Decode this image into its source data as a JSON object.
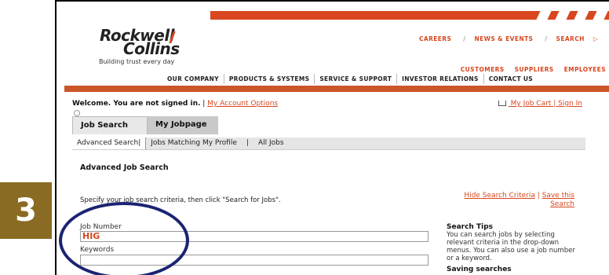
{
  "step_number": "3",
  "brand": {
    "line1": "Rockwell",
    "line2": "Collins",
    "tagline": "Building trust every day"
  },
  "top_links": [
    "CAREERS",
    "NEWS & EVENTS",
    "SEARCH"
  ],
  "audience_links": [
    "CUSTOMERS",
    "SUPPLIERS",
    "EMPLOYEES"
  ],
  "nav": [
    "OUR COMPANY",
    "PRODUCTS & SYSTEMS",
    "SERVICE & SUPPORT",
    "INVESTOR RELATIONS",
    "CONTACT US"
  ],
  "welcome": {
    "text": "Welcome. You are not signed in.",
    "sep": "|",
    "account_link": "My Account Options"
  },
  "cart": {
    "label": "My Job Cart",
    "sep": "|",
    "signin": "Sign In"
  },
  "tabs": [
    "Job Search",
    "My Jobpage"
  ],
  "subtabs": [
    "Advanced Search|",
    "Jobs Matching My Profile",
    "|",
    "All Jobs"
  ],
  "section_title": "Advanced Job Search",
  "criteria_text": "Specify your job search criteria, then click \"Search for Jobs\".",
  "hide_criteria": "Hide Search Criteria",
  "save_search_line1": "Save this",
  "save_search_line2": "Search",
  "job_number": {
    "label": "Job Number",
    "value": "HIG"
  },
  "keywords": {
    "label": "Keywords",
    "value": ""
  },
  "tips": {
    "title": "Search Tips",
    "body": "You can search jobs by selecting relevant criteria in the drop-down menus. You can also use a job number or a keyword.",
    "saving_title": "Saving searches"
  },
  "colors": {
    "accent": "#d8471f",
    "badge": "#8a6b23",
    "circle": "#1b2472"
  }
}
